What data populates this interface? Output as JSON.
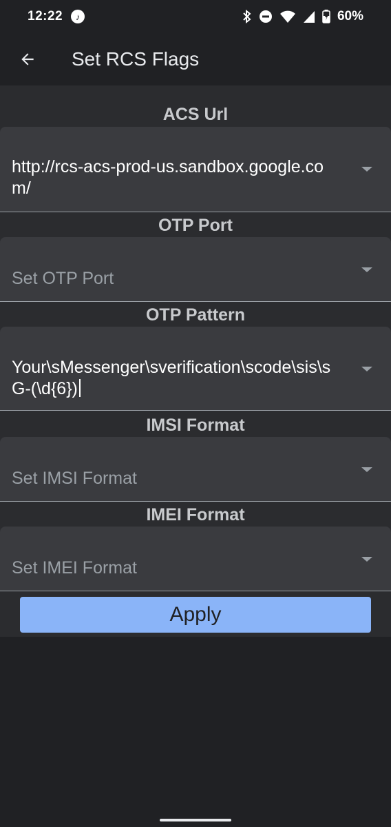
{
  "status_bar": {
    "time": "12:22",
    "battery": "60%",
    "icons": [
      "music-note-icon",
      "bluetooth-icon",
      "do-not-disturb-icon",
      "wifi-icon",
      "cell-signal-icon",
      "battery-charging-icon"
    ]
  },
  "app_bar": {
    "title": "Set RCS Flags",
    "back_icon": "arrow-back-icon"
  },
  "fields": {
    "acs_url": {
      "label": "ACS Url",
      "value": "http://rcs-acs-prod-us.sandbox.google.com/"
    },
    "otp_port": {
      "label": "OTP Port",
      "placeholder": "Set OTP Port"
    },
    "otp_pattern": {
      "label": "OTP Pattern",
      "value": "Your\\sMessenger\\sverification\\scode\\sis\\sG-(\\d{6})"
    },
    "imsi_format": {
      "label": "IMSI Format",
      "placeholder": "Set IMSI Format"
    },
    "imei_format": {
      "label": "IMEI Format",
      "placeholder": "Set IMEI Format"
    }
  },
  "actions": {
    "apply_label": "Apply"
  },
  "colors": {
    "background": "#202124",
    "surface": "#2b2c2f",
    "field": "#3a3b3f",
    "accent": "#8ab4f8"
  }
}
